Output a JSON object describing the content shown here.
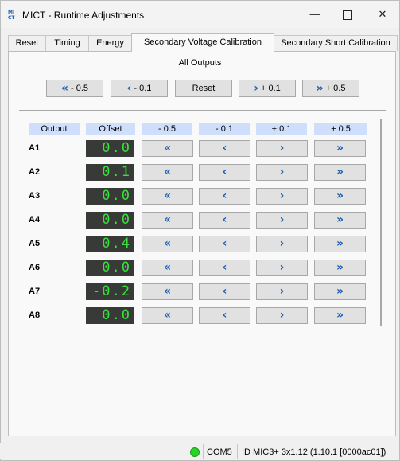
{
  "window": {
    "icon_text": "MI CT",
    "title": "MICT - Runtime Adjustments",
    "min_glyph": "—",
    "close_glyph": "✕"
  },
  "tabs": [
    {
      "label": "Reset"
    },
    {
      "label": "Timing"
    },
    {
      "label": "Energy"
    },
    {
      "label": "Secondary Voltage Calibration",
      "active": true
    },
    {
      "label": "Secondary Short Calibration"
    }
  ],
  "all_outputs": {
    "label": "All Outputs",
    "buttons": [
      {
        "icon": "«",
        "text": " - 0.5"
      },
      {
        "icon": "‹",
        "text": " - 0.1"
      },
      {
        "icon": "",
        "text": "Reset"
      },
      {
        "icon": "›",
        "text": " + 0.1"
      },
      {
        "icon": "»",
        "text": " + 0.5"
      }
    ]
  },
  "table": {
    "headers": [
      "Output",
      "Offset",
      "- 0.5",
      "- 0.1",
      "+ 0.1",
      "+ 0.5"
    ],
    "button_icons": [
      "«",
      "‹",
      "›",
      "»"
    ],
    "rows": [
      {
        "label": "A1",
        "offset": "0.0"
      },
      {
        "label": "A2",
        "offset": "0.1"
      },
      {
        "label": "A3",
        "offset": "0.0"
      },
      {
        "label": "A4",
        "offset": "0.0"
      },
      {
        "label": "A5",
        "offset": "0.4"
      },
      {
        "label": "A6",
        "offset": "0.0"
      },
      {
        "label": "A7",
        "offset": "-0.2"
      },
      {
        "label": "A8",
        "offset": "0.0"
      }
    ]
  },
  "status": {
    "port": "COM5",
    "device": "ID MIC3+ 3x1.12 (1.10.1 [0000ac01])",
    "led_color": "#26d426"
  },
  "colors": {
    "accent": "#1e5fb0",
    "lcd_bg": "#383a38",
    "lcd_fg": "#39e23b",
    "header_bg": "#cfdffb"
  }
}
